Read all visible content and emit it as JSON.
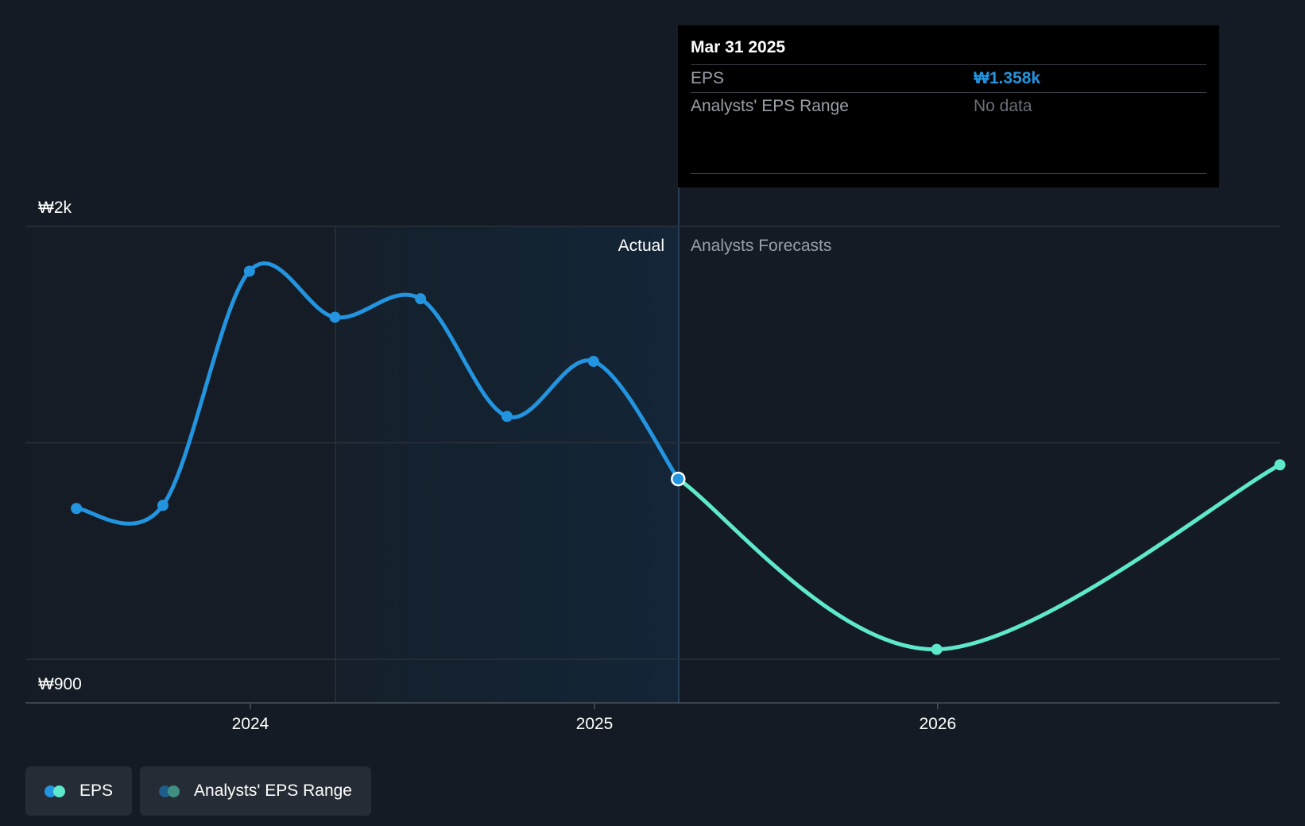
{
  "chart_data": {
    "type": "line",
    "y_axis": {
      "labels": [
        "₩2k",
        "₩900"
      ],
      "range": [
        900,
        2000
      ],
      "gridlines": [
        900,
        1450,
        2000
      ]
    },
    "x_axis": {
      "ticks": [
        "2024",
        "2025",
        "2026"
      ]
    },
    "region_labels": {
      "actual": "Actual",
      "forecast": "Analysts Forecasts"
    },
    "series": [
      {
        "name": "EPS",
        "color": "#2394df",
        "points": [
          {
            "date": "2023-06-30",
            "value": 1283
          },
          {
            "date": "2023-09-30",
            "value": 1291
          },
          {
            "date": "2023-12-31",
            "value": 1886
          },
          {
            "date": "2024-03-31",
            "value": 1769
          },
          {
            "date": "2024-06-30",
            "value": 1816
          },
          {
            "date": "2024-09-30",
            "value": 1517
          },
          {
            "date": "2024-12-31",
            "value": 1657
          },
          {
            "date": "2025-03-31",
            "value": 1358
          }
        ]
      },
      {
        "name": "EPS",
        "color": "#5ee8cc",
        "points": [
          {
            "date": "2025-03-31",
            "value": 1358
          },
          {
            "date": "2025-12-31",
            "value": 925
          },
          {
            "date": "2026-12-31",
            "value": 1394
          }
        ]
      }
    ]
  },
  "tooltip": {
    "date": "Mar 31 2025",
    "eps_label": "EPS",
    "eps_value": "₩1.358k",
    "range_label": "Analysts' EPS Range",
    "range_value": "No data"
  },
  "legend": {
    "items": [
      {
        "label": "EPS",
        "colors": [
          "#2394df",
          "#5ee8cc"
        ]
      },
      {
        "label": "Analysts' EPS Range",
        "colors": [
          "#1f5d8c",
          "#3f8f82"
        ]
      }
    ]
  }
}
